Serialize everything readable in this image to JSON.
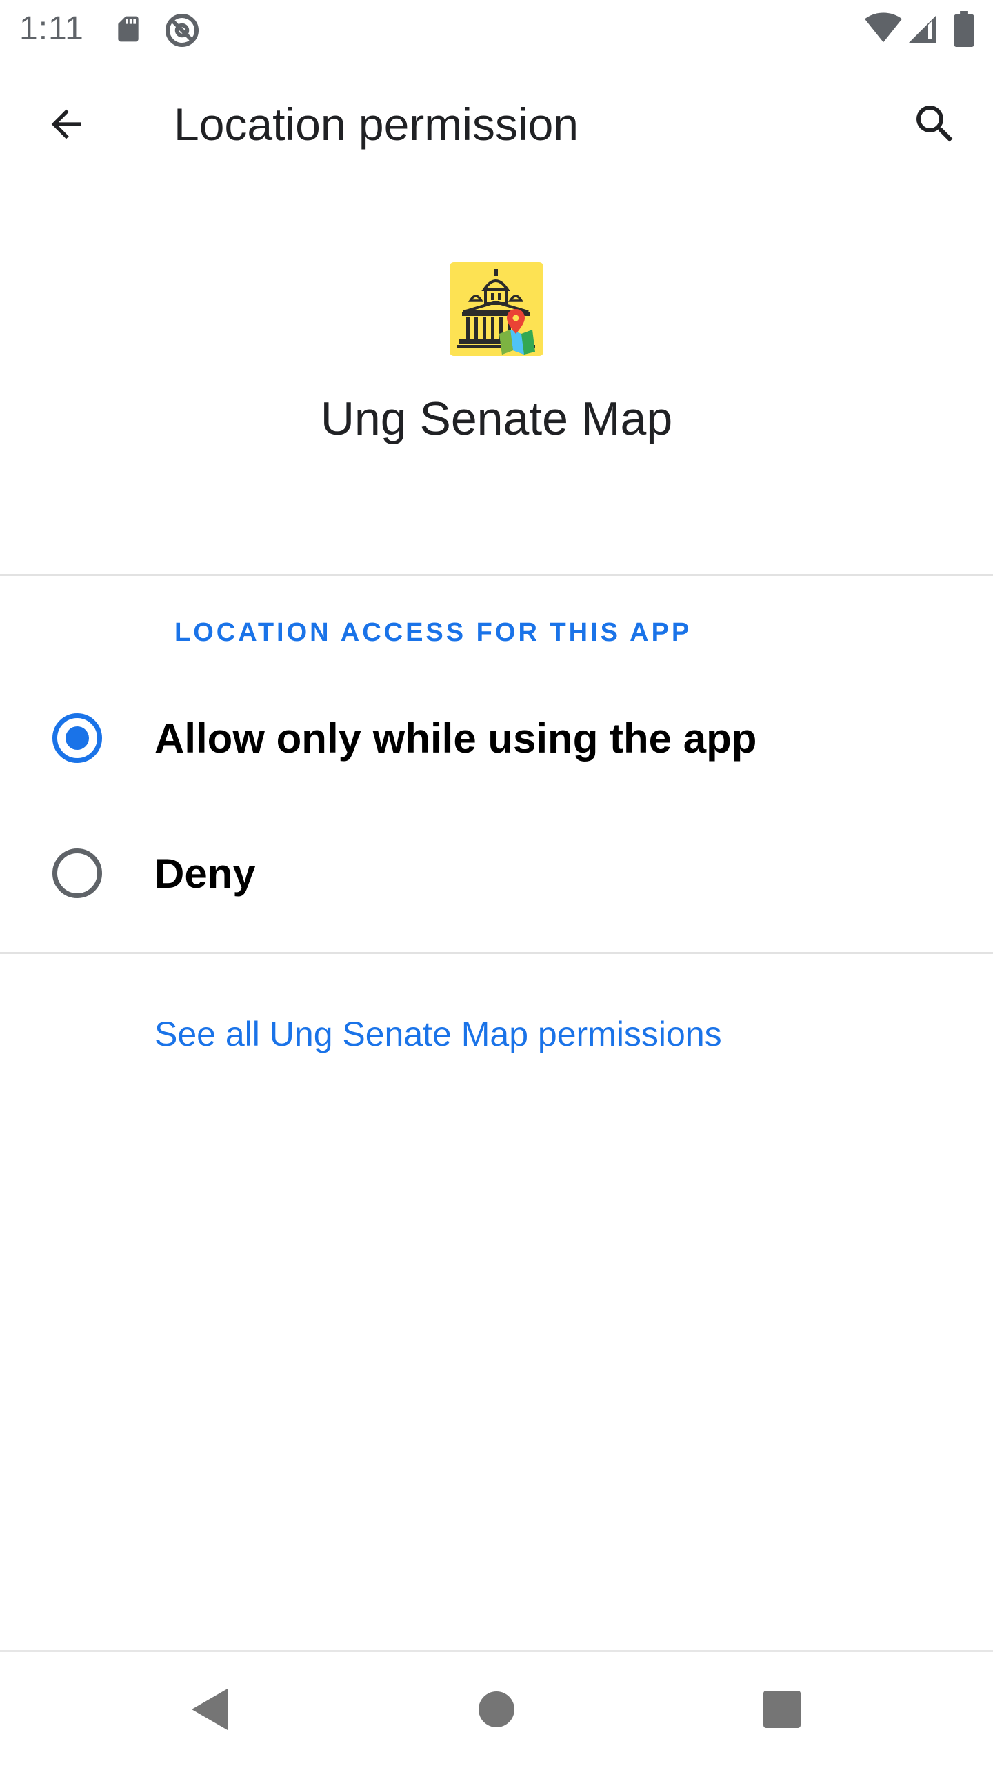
{
  "status_bar": {
    "time": "1:11",
    "icons": [
      "sd-card-icon",
      "no-sync-icon",
      "wifi-icon",
      "signal-icon",
      "battery-icon"
    ]
  },
  "app_bar": {
    "title": "Location permission",
    "back_icon": "arrow-back-icon",
    "search_icon": "search-icon"
  },
  "header": {
    "app_name": "Ung Senate Map",
    "app_icon": "senate-map-app-icon"
  },
  "section": {
    "label": "LOCATION ACCESS FOR THIS APP"
  },
  "options": [
    {
      "label": "Allow only while using the app",
      "selected": true
    },
    {
      "label": "Deny",
      "selected": false
    }
  ],
  "footer_link": "See all Ung Senate Map permissions",
  "nav_bar": {
    "icons": [
      "back-triangle-icon",
      "home-circle-icon",
      "recents-square-icon"
    ]
  },
  "colors": {
    "accent": "#1a73e8",
    "icon_background": "#fde253",
    "text_primary": "#202124",
    "divider": "#e2e2e2"
  }
}
